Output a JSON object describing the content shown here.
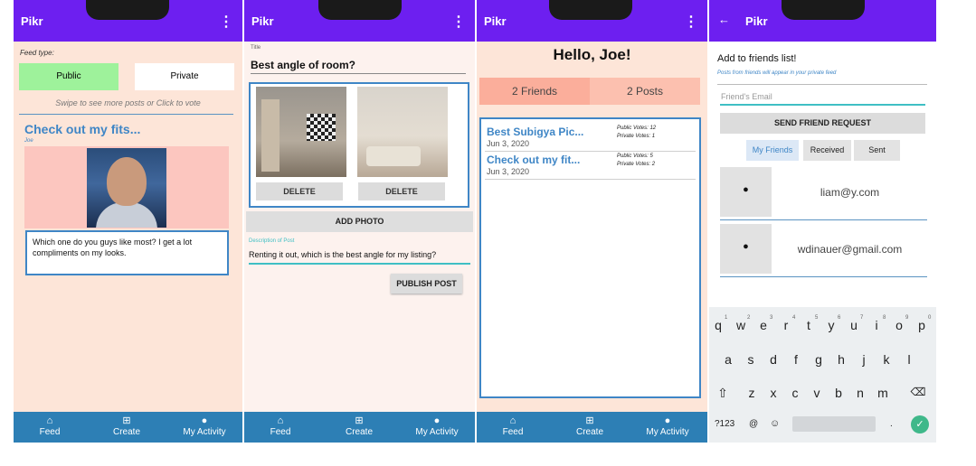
{
  "app_name": "Pikr",
  "menu_glyph": "⋮",
  "nav": {
    "feed": "Feed",
    "create": "Create",
    "activity": "My Activity"
  },
  "feed": {
    "feed_type_label": "Feed type:",
    "public_label": "Public",
    "private_label": "Private",
    "hint": "Swipe to see more posts or Click to vote",
    "post_title": "Check out my fits...",
    "post_author": "Joe",
    "comment": "Which one do you guys like most? I get a lot compliments on my looks."
  },
  "create": {
    "title_label": "Title",
    "title_value": "Best angle of room?",
    "delete_label": "DELETE",
    "add_photo_label": "ADD PHOTO",
    "description_label": "Description of Post",
    "description_value": "Renting it out, which is the best angle for my listing?",
    "publish_label": "PUBLISH POST"
  },
  "activity": {
    "greeting": "Hello, Joe!",
    "friends_count": "2 Friends",
    "posts_count": "2 Posts",
    "posts": [
      {
        "title": "Best Subigya Pic...",
        "date": "Jun 3, 2020",
        "public_votes": "Public Votes: 12",
        "private_votes": "Private Votes: 1"
      },
      {
        "title": "Check out my fit...",
        "date": "Jun 3, 2020",
        "public_votes": "Public Votes: 5",
        "private_votes": "Private Votes: 2"
      }
    ]
  },
  "friends": {
    "back_glyph": "←",
    "heading": "Add to friends list!",
    "subheading": "Posts from friends will appear in your private feed",
    "email_placeholder": "Friend's Email",
    "send_label": "SEND FRIEND REQUEST",
    "tabs": [
      "My Friends",
      "Received",
      "Sent"
    ],
    "list": [
      "liam@y.com",
      "wdinauer@gmail.com"
    ]
  },
  "keyboard": {
    "row1": [
      "q",
      "w",
      "e",
      "r",
      "t",
      "y",
      "u",
      "i",
      "o",
      "p"
    ],
    "row1_sup": [
      "1",
      "2",
      "3",
      "4",
      "5",
      "6",
      "7",
      "8",
      "9",
      "0"
    ],
    "row2": [
      "a",
      "s",
      "d",
      "f",
      "g",
      "h",
      "j",
      "k",
      "l"
    ],
    "row3": [
      "z",
      "x",
      "c",
      "v",
      "b",
      "n",
      "m"
    ],
    "symbols_key": "?123",
    "at_key": "@",
    "period_key": "."
  },
  "colors": {
    "appbar": "#6d1ff0",
    "bottom_nav": "#2d7fb5",
    "accent_blue": "#3f86c6",
    "public_green": "#9ef29b",
    "background_peach": "#fde5d8"
  },
  "icons": {
    "feed": "home-icon",
    "create": "add-box-icon",
    "activity": "person-icon",
    "friend": "person-icon",
    "backspace": "backspace-icon",
    "shift": "shift-icon",
    "emoji": "emoji-icon",
    "enter": "check-icon"
  }
}
